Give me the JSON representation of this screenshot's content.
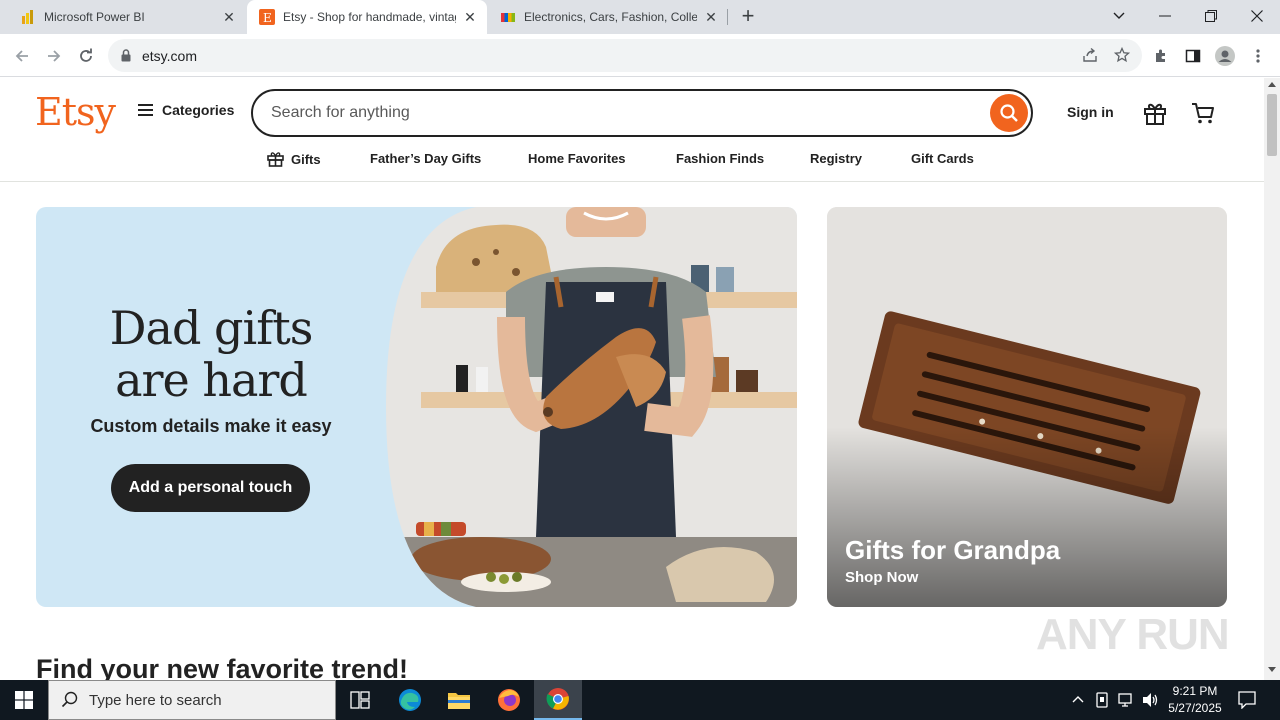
{
  "browser": {
    "tabs": [
      {
        "title": "Microsoft Power BI",
        "favicon": "powerbi-icon",
        "active": false
      },
      {
        "title": "Etsy - Shop for handmade, vintage",
        "favicon": "etsy-icon",
        "active": true
      },
      {
        "title": "Electronics, Cars, Fashion, Collectibles",
        "favicon": "ebay-icon",
        "active": false
      }
    ],
    "new_tab_label": "+",
    "url": "etsy.com"
  },
  "header": {
    "logo": "Etsy",
    "categories_label": "Categories",
    "search_placeholder": "Search for anything",
    "signin_label": "Sign in"
  },
  "nav": {
    "items": [
      {
        "label": "Gifts",
        "icon": "gift-icon"
      },
      {
        "label": "Father’s Day Gifts"
      },
      {
        "label": "Home Favorites"
      },
      {
        "label": "Fashion Finds"
      },
      {
        "label": "Registry"
      },
      {
        "label": "Gift Cards"
      }
    ]
  },
  "hero": {
    "headline_line1": "Dad gifts",
    "headline_line2": "are hard",
    "subheadline": "Custom details make it easy",
    "cta_label": "Add a personal touch"
  },
  "promo": {
    "title": "Gifts for Grandpa",
    "link": "Shop Now"
  },
  "section": {
    "title": "Find your new favorite trend!"
  },
  "watermark": "ANY RUN",
  "taskbar": {
    "search_placeholder": "Type here to search",
    "time": "9:21 PM",
    "date": "5/27/2025"
  },
  "colors": {
    "etsy_orange": "#f1641e",
    "hero_blue": "#cfe7f5",
    "dark": "#222222",
    "taskbar": "#101820"
  }
}
